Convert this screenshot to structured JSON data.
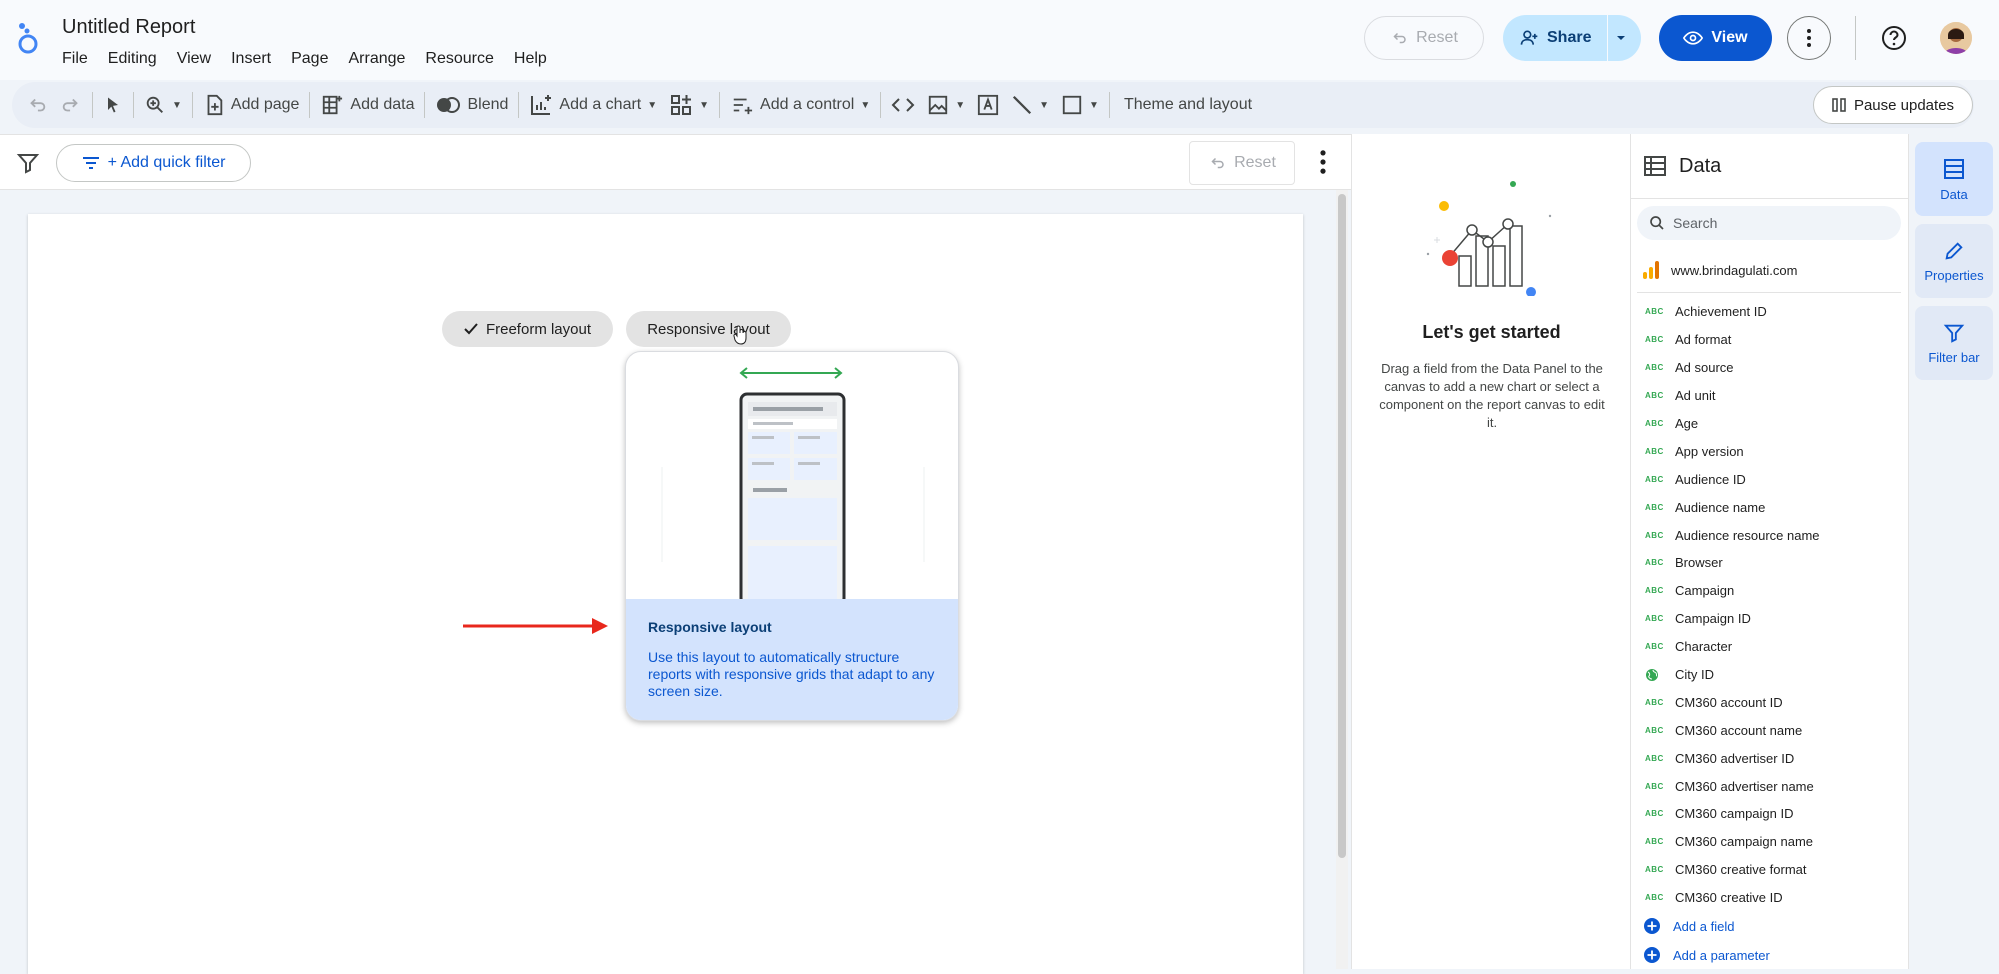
{
  "header": {
    "title": "Untitled Report",
    "menu": [
      "File",
      "Editing",
      "View",
      "Insert",
      "Page",
      "Arrange",
      "Resource",
      "Help"
    ],
    "reset_label": "Reset",
    "share_label": "Share",
    "view_label": "View"
  },
  "toolbar": {
    "add_page": "Add page",
    "add_data": "Add data",
    "blend": "Blend",
    "add_chart": "Add a chart",
    "add_control": "Add a control",
    "theme_layout": "Theme and layout",
    "pause_updates": "Pause updates"
  },
  "filterbar": {
    "add_quick_filter": "+ Add quick filter",
    "reset_label": "Reset"
  },
  "canvas": {
    "freeform_label": "Freeform layout",
    "responsive_label": "Responsive layout",
    "tooltip_title": "Responsive layout",
    "tooltip_desc": "Use this layout to automatically structure reports with responsive grids that adapt to any screen size."
  },
  "started": {
    "title": "Let's get started",
    "desc": "Drag a field from the Data Panel to the canvas to add a new chart or select a component on the report canvas to edit it."
  },
  "data_panel": {
    "title": "Data",
    "search_placeholder": "Search",
    "source": "www.brindagulati.com",
    "fields": [
      {
        "name": "Achievement ID",
        "type": "text"
      },
      {
        "name": "Ad format",
        "type": "text"
      },
      {
        "name": "Ad source",
        "type": "text"
      },
      {
        "name": "Ad unit",
        "type": "text"
      },
      {
        "name": "Age",
        "type": "text"
      },
      {
        "name": "App version",
        "type": "text"
      },
      {
        "name": "Audience ID",
        "type": "text"
      },
      {
        "name": "Audience name",
        "type": "text"
      },
      {
        "name": "Audience resource name",
        "type": "text"
      },
      {
        "name": "Browser",
        "type": "text"
      },
      {
        "name": "Campaign",
        "type": "text"
      },
      {
        "name": "Campaign ID",
        "type": "text"
      },
      {
        "name": "Character",
        "type": "text"
      },
      {
        "name": "City ID",
        "type": "geo"
      },
      {
        "name": "CM360 account ID",
        "type": "text"
      },
      {
        "name": "CM360 account name",
        "type": "text"
      },
      {
        "name": "CM360 advertiser ID",
        "type": "text"
      },
      {
        "name": "CM360 advertiser name",
        "type": "text"
      },
      {
        "name": "CM360 campaign ID",
        "type": "text"
      },
      {
        "name": "CM360 campaign name",
        "type": "text"
      },
      {
        "name": "CM360 creative format",
        "type": "text"
      },
      {
        "name": "CM360 creative ID",
        "type": "text"
      }
    ],
    "text_type_badge": "ABC",
    "add_field": "Add a field",
    "add_parameter": "Add a parameter"
  },
  "rail": {
    "data": "Data",
    "properties": "Properties",
    "filter_bar": "Filter bar"
  },
  "colors": {
    "accent": "#0b57d0",
    "share_bg": "#c2e7ff",
    "tooltip_bg": "#d3e3fd",
    "arrow": "#e8271c",
    "field_green": "#34a853"
  }
}
